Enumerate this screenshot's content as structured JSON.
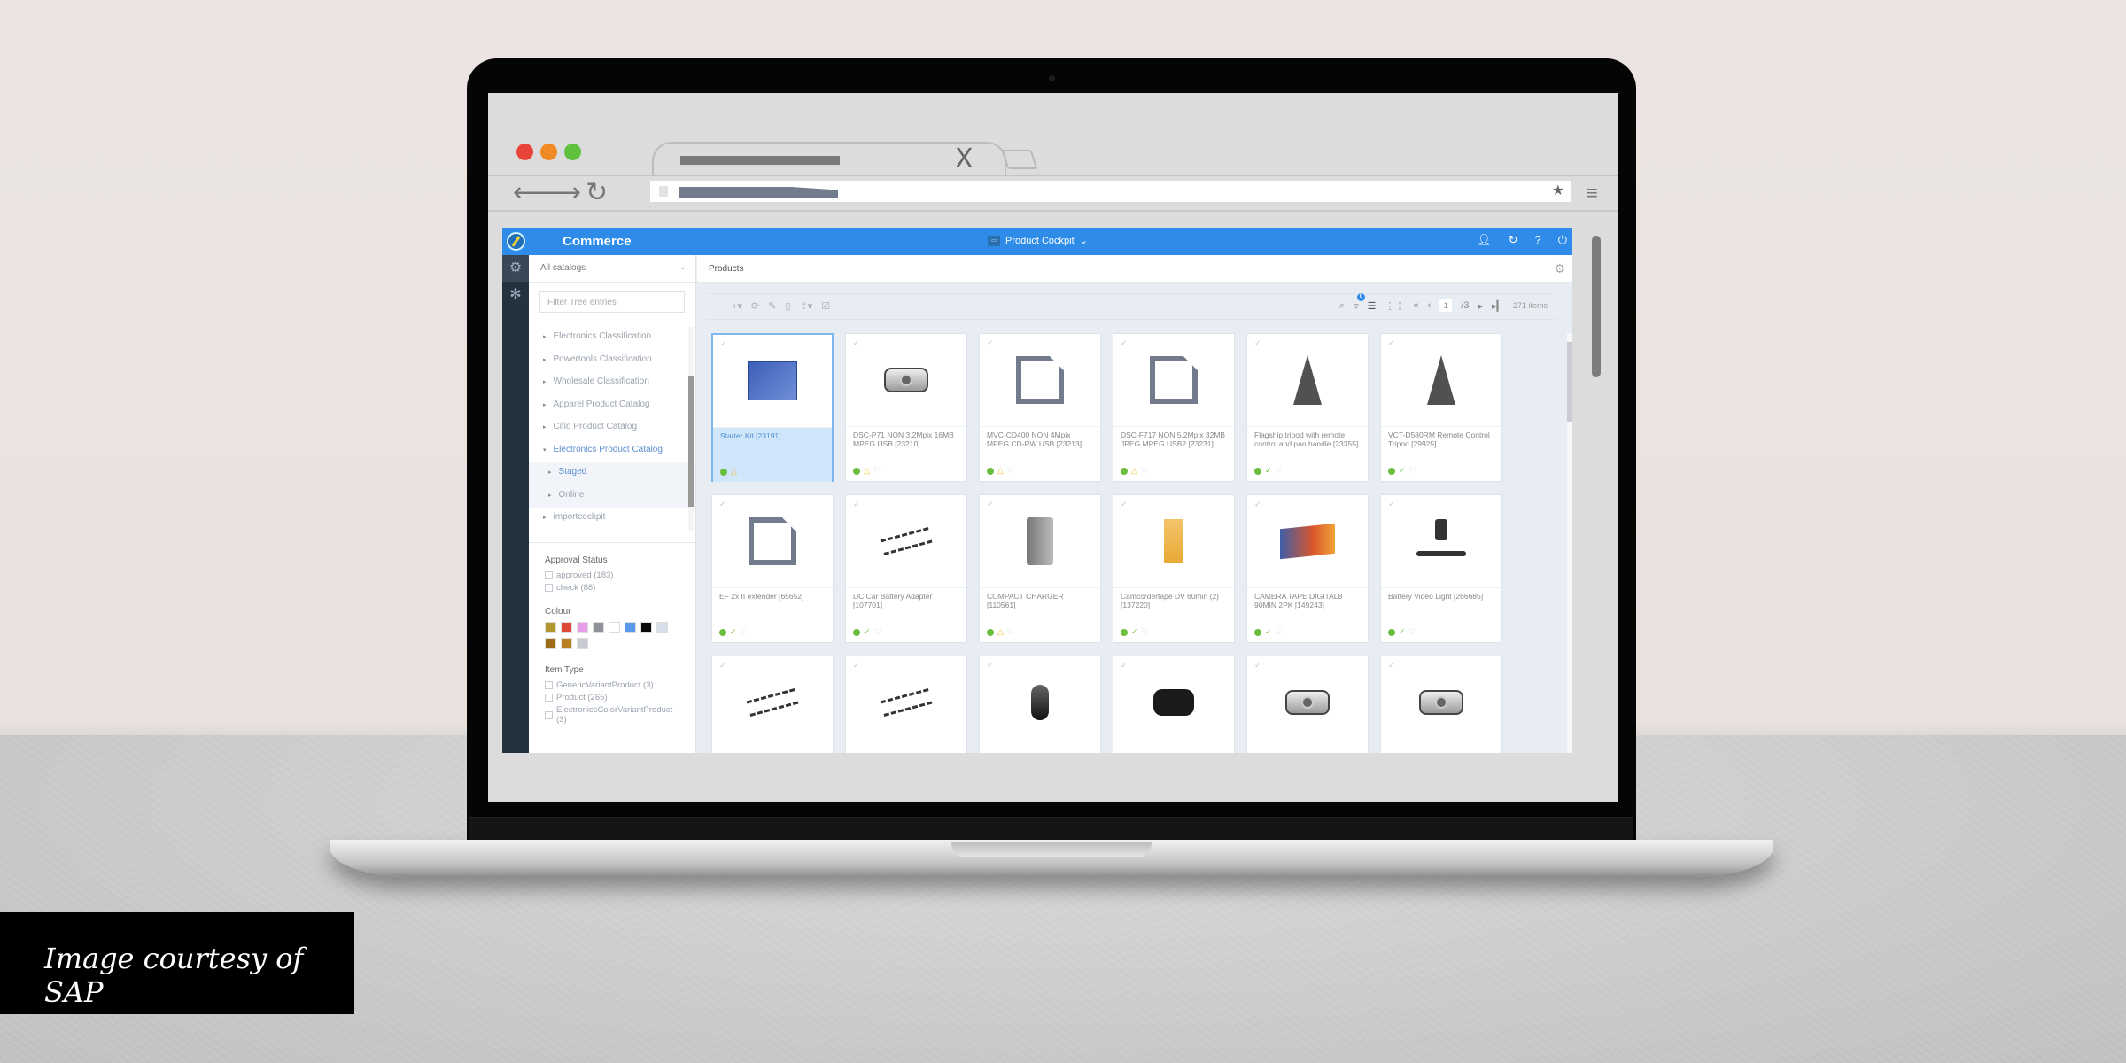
{
  "browser": {
    "traffic_lights": [
      "#e8443a",
      "#f08a24",
      "#5fc13d"
    ],
    "tab_close_icon": "X",
    "nav_back": "⟵",
    "nav_forward": "⟶",
    "reload": "↻",
    "bookmark": "★",
    "menu": "≡"
  },
  "app": {
    "brand": "Commerce",
    "accent": "#2e8ce8",
    "perspective": "Product Cockpit",
    "perspective_chevron": "⌄",
    "topbar_icons": [
      "user-icon",
      "refresh-icon",
      "help-icon",
      "power-icon"
    ],
    "rail_icons": [
      "explorer-icon",
      "network-icon"
    ]
  },
  "tree": {
    "catalog_select": "All catalogs",
    "filter_placeholder": "Filter Tree entries",
    "items": [
      {
        "label": "Electronics Classification"
      },
      {
        "label": "Powertools Classification"
      },
      {
        "label": "Wholesale Classification"
      },
      {
        "label": "Apparel Product Catalog"
      },
      {
        "label": "Citio Product Catalog"
      },
      {
        "label": "Electronics Product Catalog",
        "expanded": true
      },
      {
        "label": "Staged",
        "child": true,
        "selected": true
      },
      {
        "label": "Online",
        "child": true
      },
      {
        "label": "importcockpit"
      }
    ]
  },
  "facets": {
    "approval": {
      "title": "Approval Status",
      "options": [
        "approved (183)",
        "check (88)"
      ]
    },
    "colour": {
      "title": "Colour",
      "swatches": [
        "#b5962c",
        "#e0493a",
        "#e79de8",
        "#8e9197",
        "#ffffff",
        "#5a98ea",
        "#0a0a0a",
        "#d9dfea",
        "#9c6b13",
        "#b8801f",
        "#c7cbd1"
      ]
    },
    "item_type": {
      "title": "Item Type",
      "options": [
        "GenericVariantProduct (3)",
        "Product (265)",
        "ElectronicsColorVariantProduct (3)"
      ]
    }
  },
  "main": {
    "title": "Products",
    "toolbar": {
      "filter_badge": "0",
      "page": "1",
      "page_total": "/3",
      "items": "271 items"
    },
    "products": [
      {
        "name": "Starter Kit [23191]",
        "img": "box",
        "status": [
          "info",
          "warn",
          "none"
        ],
        "selected": true
      },
      {
        "name": "DSC-P71 NON 3.2Mpix 16MB MPEG USB [23210]",
        "img": "camera",
        "status": [
          "info",
          "warn",
          "none"
        ]
      },
      {
        "name": "MVC-CD400 NON 4Mpix MPEG CD-RW USB [23213]",
        "img": "placeholder",
        "status": [
          "info",
          "warn",
          "none"
        ]
      },
      {
        "name": "DSC-F717 NON 5.2Mpix 32MB JPEG MPEG USB2 [23231]",
        "img": "placeholder",
        "status": [
          "info",
          "warn",
          "none"
        ]
      },
      {
        "name": "Flagship tripod with remote control and pan handle [23355]",
        "img": "tripod",
        "status": [
          "info",
          "ok",
          "none"
        ]
      },
      {
        "name": "VCT-D580RM Remote Control Tripod [29925]",
        "img": "tripod",
        "status": [
          "info",
          "ok",
          "none"
        ]
      },
      {
        "name": "EF 2x II extender [65652]",
        "img": "placeholder",
        "status": [
          "info",
          "ok",
          "none"
        ]
      },
      {
        "name": "DC Car Battery Adapter [107701]",
        "img": "cable",
        "status": [
          "info",
          "ok",
          "none"
        ]
      },
      {
        "name": "COMPACT CHARGER [110561]",
        "img": "charger",
        "status": [
          "info",
          "warn",
          "none"
        ]
      },
      {
        "name": "Camcordertape DV 60min (2) [137220]",
        "img": "tape",
        "status": [
          "info",
          "ok",
          "none"
        ]
      },
      {
        "name": "CAMERA TAPE DIGITAL8 90MIN 2PK [149243]",
        "img": "box2",
        "status": [
          "info",
          "ok",
          "none"
        ]
      },
      {
        "name": "Battery Video Light [266685]",
        "img": "light",
        "status": [
          "info",
          "ok",
          "none"
        ]
      },
      {
        "name": "",
        "img": "cable",
        "status": []
      },
      {
        "name": "",
        "img": "cable",
        "status": []
      },
      {
        "name": "",
        "img": "webcam",
        "status": []
      },
      {
        "name": "",
        "img": "binoculars",
        "status": []
      },
      {
        "name": "",
        "img": "camera",
        "status": []
      },
      {
        "name": "",
        "img": "camera",
        "status": []
      }
    ]
  },
  "credit": "Image courtesy of SAP"
}
